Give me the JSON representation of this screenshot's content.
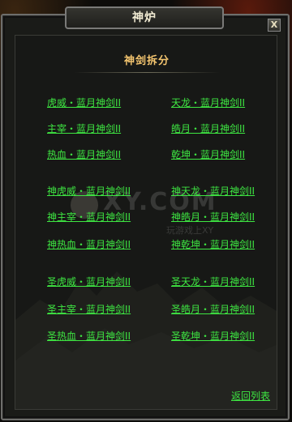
{
  "window": {
    "title": "神炉",
    "close_label": "X"
  },
  "panel": {
    "heading": "神剑拆分",
    "back_label": "返回列表"
  },
  "groups": [
    {
      "left": [
        "虎威・蓝月神剑II",
        "主宰・蓝月神剑II",
        "热血・蓝月神剑II"
      ],
      "right": [
        "天龙・蓝月神剑II",
        "皓月・蓝月神剑II",
        "乾坤・蓝月神剑II"
      ]
    },
    {
      "left": [
        "神虎威・蓝月神剑II",
        "神主宰・蓝月神剑II",
        "神热血・蓝月神剑II"
      ],
      "right": [
        "神天龙・蓝月神剑II",
        "神皓月・蓝月神剑II",
        "神乾坤・蓝月神剑II"
      ]
    },
    {
      "left": [
        "圣虎威・蓝月神剑II",
        "圣主宰・蓝月神剑II",
        "圣热血・蓝月神剑II"
      ],
      "right": [
        "圣天龙・蓝月神剑II",
        "圣皓月・蓝月神剑II",
        "圣乾坤・蓝月神剑II"
      ]
    }
  ],
  "watermark": {
    "text": "XY.COM",
    "subtext": "玩游戏上XY"
  },
  "colors": {
    "link": "#3ee642",
    "heading": "#f4c56f",
    "title": "#f0ead2"
  }
}
